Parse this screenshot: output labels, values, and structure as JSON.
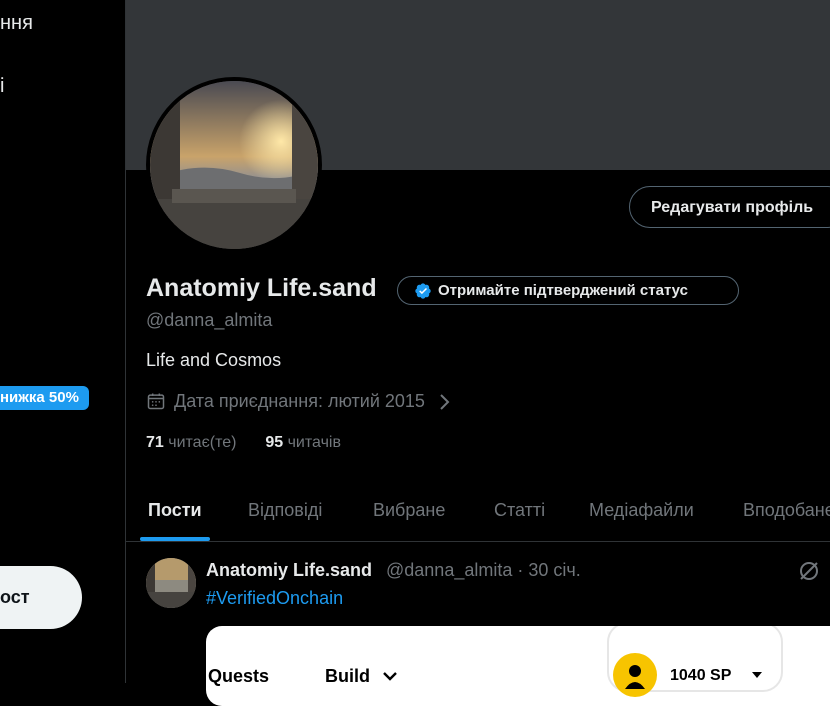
{
  "sidebar": {
    "nav_items": [
      {
        "label": "ння"
      },
      {
        "label": "і"
      }
    ],
    "promo_badge": "нижка 50%",
    "post_button": "ост"
  },
  "profile": {
    "edit_button": "Редагувати профіль",
    "display_name": "Anatomiy Life.sand",
    "verify_button": "Отримайте підтверджений статус",
    "handle": "@danna_almita",
    "bio": "Life and Cosmos",
    "joined": "Дата приєднання: лютий 2015",
    "following_count": "71",
    "following_label": "читає(те)",
    "followers_count": "95",
    "followers_label": "читачів"
  },
  "tabs": [
    {
      "label": "Пости",
      "active": true
    },
    {
      "label": "Відповіді"
    },
    {
      "label": "Вибране"
    },
    {
      "label": "Статті"
    },
    {
      "label": "Медіафайли"
    },
    {
      "label": "Вподобане"
    }
  ],
  "tweet": {
    "author": "Anatomiy Life.sand",
    "meta": "@danna_almita · 30 січ.",
    "hashtag": "#VerifiedOnchain",
    "card": {
      "quests": "Quests",
      "build": "Build",
      "sp": "1040 SP"
    }
  },
  "colors": {
    "accent": "#1d9bf0",
    "background": "#000000",
    "banner": "#333639",
    "muted_text": "#71767b"
  },
  "icons": [
    "verified-badge-icon",
    "calendar-icon",
    "chevron-right-icon",
    "grok-icon",
    "chevron-down-icon",
    "user-icon",
    "caret-down-icon"
  ]
}
